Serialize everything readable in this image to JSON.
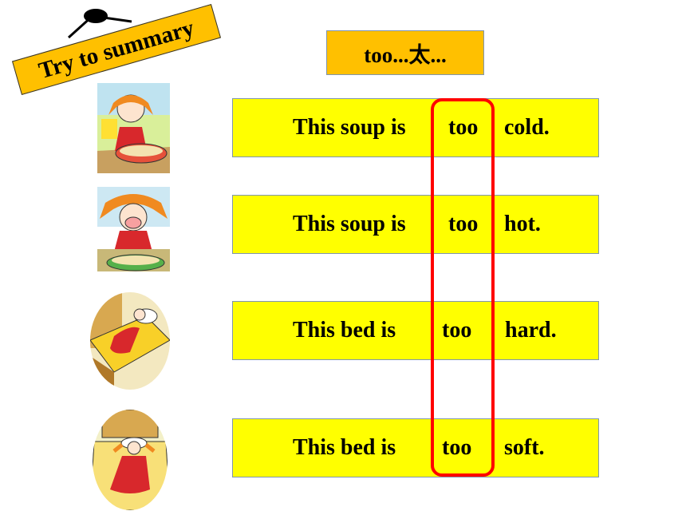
{
  "banner": {
    "label": "Try to summary",
    "color": "#ffc000"
  },
  "title": {
    "label": "too...太...",
    "color": "#ffc000"
  },
  "highlight_color": "#ff0000",
  "sentence_color": "#ffff00",
  "sentences": [
    {
      "subject": "This soup is",
      "adverb": "too",
      "adjective": "cold.",
      "picture": "girl-tasting-cold-soup"
    },
    {
      "subject": "This soup is",
      "adverb": "too",
      "adjective": "hot.",
      "picture": "girl-burned-by-hot-soup"
    },
    {
      "subject": "This bed is",
      "adverb": "too",
      "adjective": "hard.",
      "picture": "girl-on-hard-bed"
    },
    {
      "subject": "This bed is",
      "adverb": "too",
      "adjective": "soft.",
      "picture": "girl-on-soft-bed"
    }
  ]
}
